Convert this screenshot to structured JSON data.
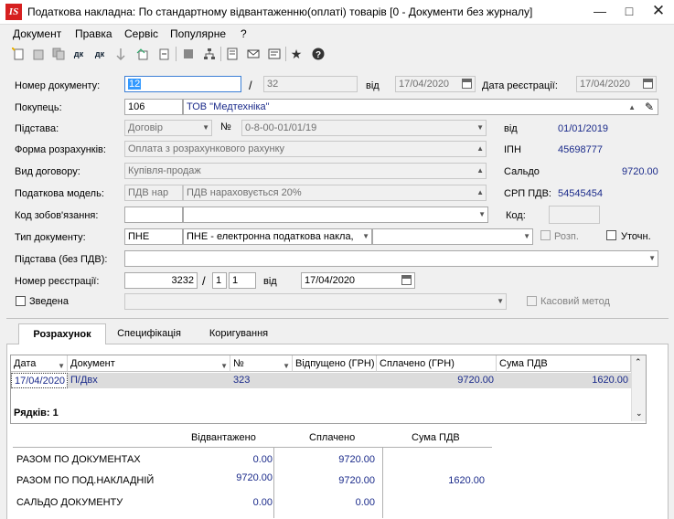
{
  "window": {
    "title": "Податкова накладна: По стандартному відвантаженню(оплаті) товарів [0 - Документи без журналу]",
    "logo": "IS"
  },
  "menu": [
    "Документ",
    "Правка",
    "Сервіс",
    "Популярне",
    "?"
  ],
  "form": {
    "doc_number_label": "Номер документу:",
    "doc_number_value": "12",
    "doc_number_sep": "/",
    "doc_number_suffix": "32",
    "from_label": "від",
    "doc_date": "17/04/2020",
    "reg_date_label": "Дата реєстрації:",
    "reg_date": "17/04/2020",
    "buyer_label": "Покупець:",
    "buyer_code": "106",
    "buyer_name": "ТОВ \"Медтехніка\"",
    "basis_label": "Підстава:",
    "basis_value": "Договір",
    "basis_no_label": "№",
    "basis_no": "0-8-00-01/01/19",
    "basis_from_label": "від",
    "basis_date": "01/01/2019",
    "payment_form_label": "Форма розрахунків:",
    "payment_form": "Оплата з розрахункового рахунку",
    "ipn_label": "ІПН",
    "ipn_value": "45698777",
    "contract_type_label": "Вид договору:",
    "contract_type": "Купівля-продаж",
    "balance_label": "Сальдо",
    "balance_value": "9720.00",
    "tax_model_label": "Податкова модель:",
    "tax_model_code": "ПДВ нар",
    "tax_model_name": "ПДВ нараховується 20%",
    "srp_label": "СРП ПДВ:",
    "srp_value": "54545454",
    "obligation_label": "Код зобов'язання:",
    "obligation_code": "",
    "obligation_name": "",
    "code_label": "Код:",
    "code_value": "",
    "doc_type_label": "Тип документу:",
    "doc_type_code": "ПНЕ",
    "doc_type_name": "ПНЕ - електронна податкова накла,",
    "doc_type_extra": "",
    "rozp_label": "Розп.",
    "utoch_label": "Уточн.",
    "basis_no_vat_label": "Підстава (без ПДВ):",
    "basis_no_vat": "",
    "reg_number_label": "Номер реєстрації:",
    "reg_number": "3232",
    "reg_number_sep": "/",
    "reg_n1": "1",
    "reg_n2": "1",
    "reg_from_label": "від",
    "reg_number_date": "17/04/2020",
    "consolidated_label": "Зведена",
    "cash_method_label": "Касовий метод"
  },
  "tabs": [
    "Розрахунок",
    "Специфікація",
    "Коригування"
  ],
  "grid": {
    "columns": [
      "Дата",
      "Документ",
      "№",
      "Відпущено (ГРН)",
      "Сплачено (ГРН)",
      "Сума ПДВ"
    ],
    "rows": [
      {
        "date": "17/04/2020",
        "doc": "П/Двх",
        "no": "323",
        "shipped": "",
        "paid": "9720.00",
        "vat": "1620.00"
      }
    ],
    "rows_count": "Рядків: 1"
  },
  "summary": {
    "headers": [
      "Відвантажено",
      "Сплачено",
      "Сума ПДВ"
    ],
    "rows": [
      {
        "label": "РАЗОМ ПО ДОКУМЕНТАХ",
        "shipped": "0.00",
        "paid": "9720.00",
        "vat": ""
      },
      {
        "label": "РАЗОМ ПО ПОД.НАКЛАДНІЙ",
        "shipped": "9720.00",
        "paid": "9720.00",
        "vat": "1620.00"
      },
      {
        "label": "САЛЬДО ДОКУМЕНТУ",
        "shipped": "0.00",
        "paid": "0.00",
        "vat": ""
      }
    ]
  },
  "colors": {
    "accent": "#3399ff",
    "value_text": "#1a2a8a",
    "logo": "#d62020"
  }
}
